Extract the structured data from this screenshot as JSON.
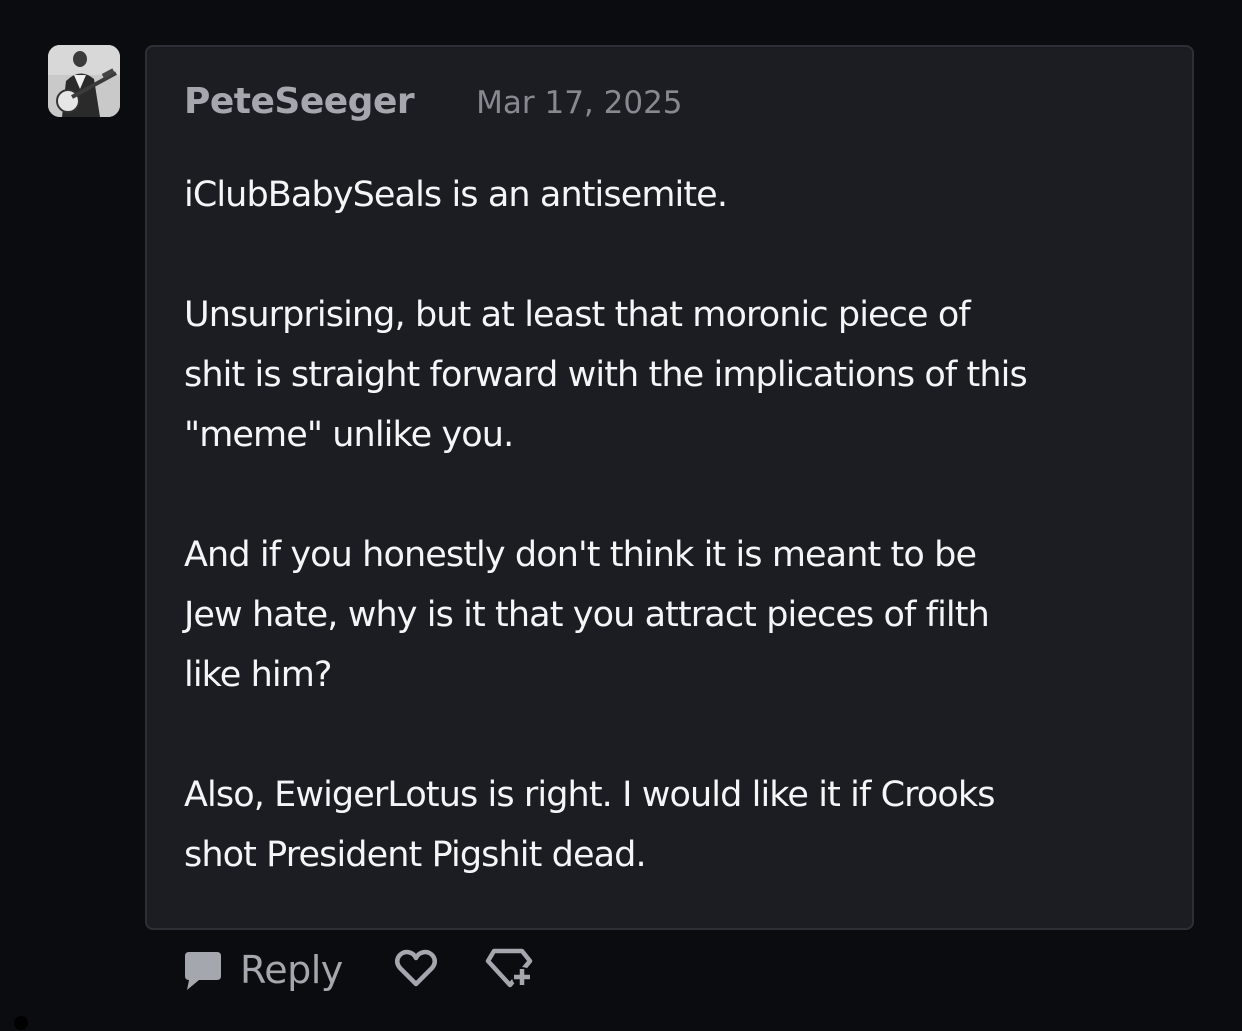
{
  "comment": {
    "author": "PeteSeeger",
    "date": "Mar 17, 2025",
    "paragraphs": [
      [
        "iClubBabySeals is an antisemite."
      ],
      [
        "Unsurprising, but at least that moronic piece of",
        "shit is straight forward with the implications of this",
        "\"meme\" unlike you."
      ],
      [
        "And if you honestly don't think it is meant to be",
        "Jew hate, why is it that you attract pieces of filth",
        "like him?"
      ],
      [
        "Also, EwigerLotus is right. I would like it if Crooks",
        "shot President Pigshit dead."
      ]
    ]
  },
  "actions": {
    "reply_label": "Reply",
    "reply_icon": "speech-bubble-icon",
    "like_icon": "heart-icon",
    "award_icon": "gem-plus-icon"
  },
  "colors": {
    "background": "#0b0c0f",
    "card": "#1b1d22",
    "card_border": "#2c2f35",
    "muted_text": "#a4a7ad",
    "body_text": "#f4f5f7"
  }
}
